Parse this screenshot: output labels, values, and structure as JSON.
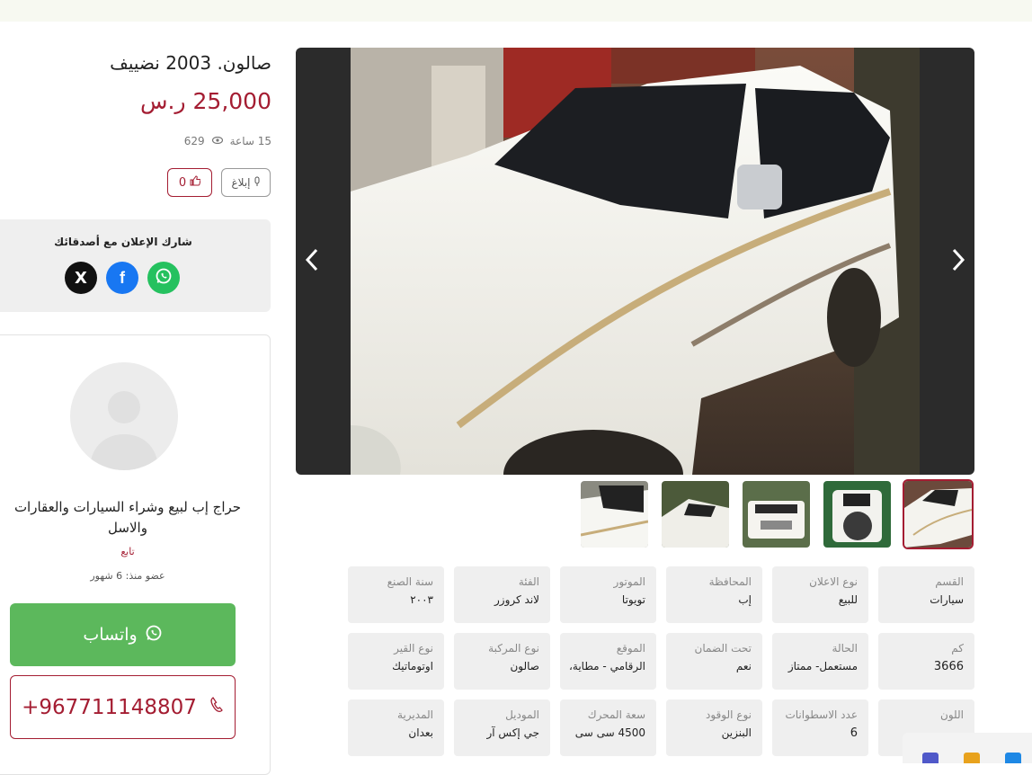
{
  "listing": {
    "title": "صالون. 2003 نضييف",
    "price": "25,000 ر.س",
    "time_ago": "15 ساعة",
    "views": "629",
    "likes": "0",
    "report_label": "إبلاغ"
  },
  "share": {
    "title": "شارك الإعلان مع أصدقائك",
    "x_label": "X",
    "facebook_label": "f"
  },
  "seller": {
    "name": "حراج إب لبيع وشراء السيارات والعقارات والاسل",
    "follow_label": "تابع",
    "member_since": "عضو منذ: 6 شهور",
    "whatsapp_label": "واتساب",
    "phone": "+967711148807"
  },
  "gallery": {
    "prev_icon": "chevron-left-icon",
    "next_icon": "chevron-right-icon",
    "thumb_count": 5,
    "active_thumb": 0
  },
  "specs": [
    {
      "label": "القسم",
      "value": "سيارات"
    },
    {
      "label": "نوع الاعلان",
      "value": "للبيع"
    },
    {
      "label": "المحافظة",
      "value": "إب"
    },
    {
      "label": "الموتور",
      "value": "تويوتا"
    },
    {
      "label": "الفئة",
      "value": "لاند كروزر"
    },
    {
      "label": "سنة الصنع",
      "value": "٢٠٠٣"
    },
    {
      "label": "كم",
      "value": "3666"
    },
    {
      "label": "الحالة",
      "value": "مستعمل- ممتاز"
    },
    {
      "label": "تحت الضمان",
      "value": "نعم"
    },
    {
      "label": "الموقع",
      "value": "الرقامي - مطاية،"
    },
    {
      "label": "نوع المركبة",
      "value": "صالون"
    },
    {
      "label": "نوع القير",
      "value": "اوتوماتيك"
    },
    {
      "label": "اللون",
      "value": ""
    },
    {
      "label": "عدد الاسطوانات",
      "value": "6"
    },
    {
      "label": "نوع الوقود",
      "value": "البنزين"
    },
    {
      "label": "سعة المحرك",
      "value": "4500 سى سى"
    },
    {
      "label": "الموديل",
      "value": "جي إكس آر"
    },
    {
      "label": "المديرية",
      "value": "بعدان"
    }
  ],
  "colors": {
    "brand": "#a41d32",
    "whatsapp": "#5cb85c"
  }
}
